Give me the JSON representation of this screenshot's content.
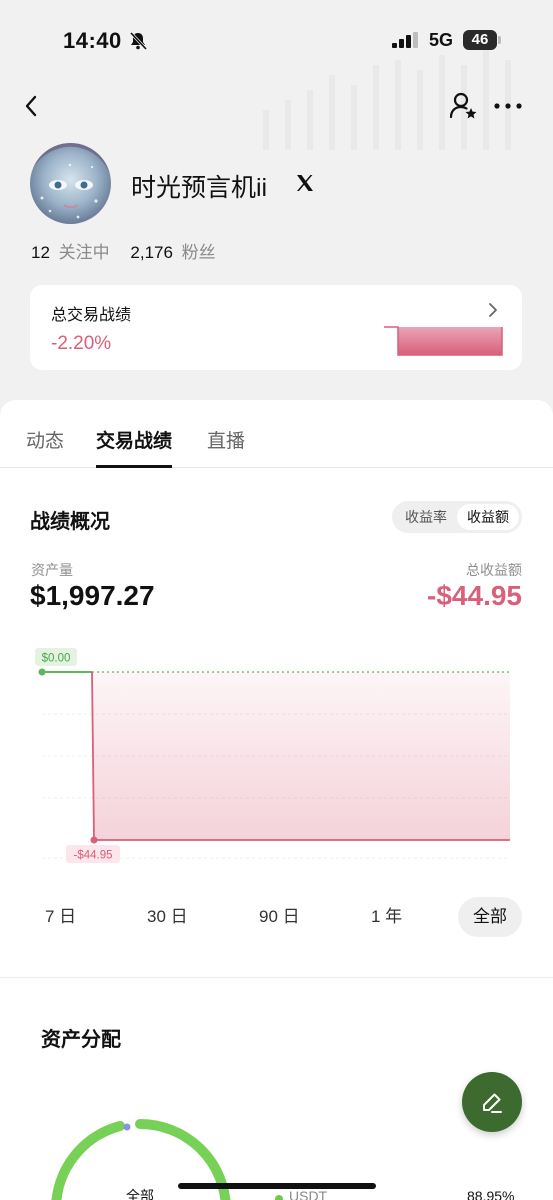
{
  "status_bar": {
    "time": "14:40",
    "network": "5G",
    "battery": "46"
  },
  "profile": {
    "name": "时光预言机ii",
    "following_count": "12",
    "following_label": "关注中",
    "followers_count": "2,176",
    "followers_label": "粉丝"
  },
  "perf_card": {
    "title": "总交易战绩",
    "value": "-2.20%"
  },
  "tabs": [
    {
      "label": "动态",
      "active": false
    },
    {
      "label": "交易战绩",
      "active": true
    },
    {
      "label": "直播",
      "active": false
    }
  ],
  "overview": {
    "title": "战绩概况",
    "toggle": [
      {
        "label": "收益率",
        "active": false
      },
      {
        "label": "收益额",
        "active": true
      }
    ],
    "assets_label": "资产量",
    "assets_value": "$1,997.27",
    "pnl_label": "总收益额",
    "pnl_value": "-$44.95"
  },
  "chart_data": {
    "type": "line",
    "series": [
      {
        "values": [
          0.0,
          0.0,
          -44.95,
          -44.95
        ]
      }
    ],
    "annotations": [
      "$0.00",
      "-$44.95"
    ],
    "ylim": [
      -44.95,
      0.0
    ],
    "grid": true
  },
  "periods": [
    {
      "label": "7 日",
      "active": false
    },
    {
      "label": "30 日",
      "active": false
    },
    {
      "label": "90 日",
      "active": false
    },
    {
      "label": "1 年",
      "active": false
    },
    {
      "label": "全部",
      "active": true
    }
  ],
  "allocation": {
    "title": "资产分配",
    "center_label": "全部",
    "legend_label": "USDT",
    "legend_pct": "88.95%"
  },
  "colors": {
    "negative": "#d95f7a",
    "positive": "#5cb85c",
    "fab": "#3d6a2f",
    "donut": "#6fca4a"
  }
}
